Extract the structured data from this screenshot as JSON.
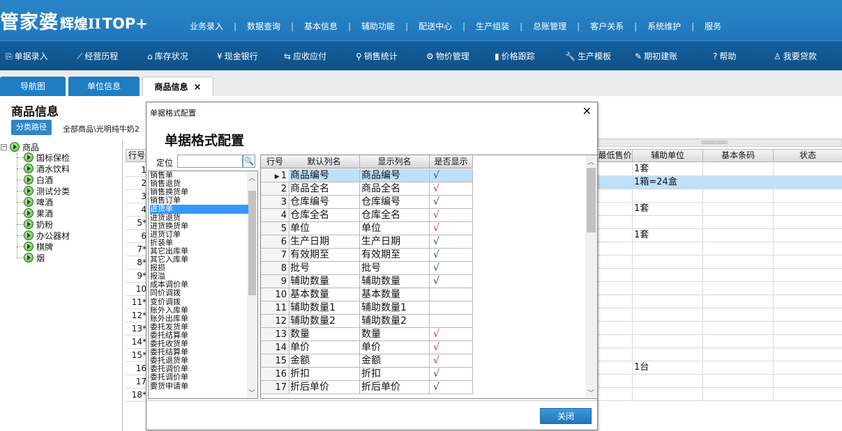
{
  "app": {
    "brand_main": "管家婆",
    "brand_sub": "辉煌II",
    "brand_top": "TOP+"
  },
  "top_menu": [
    "业务录入",
    "数据查询",
    "基本信息",
    "辅助功能",
    "配送中心",
    "生产组装",
    "总账管理",
    "客户关系",
    "系统维护",
    "服务"
  ],
  "top_menu_separator": "|",
  "toolbar": [
    {
      "label": "单据录入",
      "icon": "document-icon",
      "glyph": "⎘"
    },
    {
      "label": "经营历程",
      "icon": "chart-line-icon",
      "glyph": "⟋"
    },
    {
      "label": "库存状况",
      "icon": "home-icon",
      "glyph": "⌂"
    },
    {
      "label": "现金银行",
      "icon": "yen-icon",
      "glyph": "¥"
    },
    {
      "label": "应收应付",
      "icon": "exchange-icon",
      "glyph": "⇆"
    },
    {
      "label": "销售统计",
      "icon": "search-icon",
      "glyph": "⚲"
    },
    {
      "label": "物价管理",
      "icon": "gear-icon",
      "glyph": "⚙"
    },
    {
      "label": "价格跟踪",
      "icon": "bar-chart-icon",
      "glyph": "▮"
    },
    {
      "label": "生产模板",
      "icon": "wrench-icon",
      "glyph": "🔧"
    },
    {
      "label": "期初建账",
      "icon": "edit-icon",
      "glyph": "✎"
    },
    {
      "label": "帮助",
      "icon": "help-icon",
      "glyph": "?"
    },
    {
      "label": "我要贷款",
      "icon": "money-bag-icon",
      "glyph": "♙"
    }
  ],
  "tabs": [
    {
      "label": "导航图"
    },
    {
      "label": "单位信息"
    },
    {
      "label": "商品信息",
      "close": "×"
    }
  ],
  "page": {
    "title": "商品信息",
    "path_button": "分类路径",
    "path_text": "全部商品\\光明纯牛奶2"
  },
  "tree": {
    "root": "商品",
    "children": [
      "国标保检",
      "酒水饮料",
      "白酒",
      "测试分类",
      "啤酒",
      "果酒",
      "奶粉",
      "办公器材",
      "棋牌",
      "烟"
    ]
  },
  "background_grid": {
    "row_header": "行号",
    "row_numbers": [
      "1",
      "2",
      "3",
      "4",
      "5*",
      "6",
      "7*",
      "8*",
      "9*",
      "10",
      "11*",
      "12*",
      "13*",
      "14*",
      "15*",
      "16",
      "17",
      "18*"
    ],
    "headers": [
      "最低售价",
      "辅助单位",
      "基本条码",
      "状态"
    ],
    "aux_units": [
      "1套",
      "1箱=24盒",
      "",
      "1套",
      "",
      "1套",
      "",
      "",
      "",
      "",
      "",
      "",
      "",
      "",
      "",
      "1台",
      "",
      ""
    ],
    "selected_row": 2
  },
  "dialog": {
    "title": "单据格式配置",
    "heading": "单据格式配置",
    "close_icon": "✕",
    "locate_label": "定位",
    "locate_value": "",
    "locate_button": "🔍",
    "bill_types": [
      "销售单",
      "销售退货",
      "销售换货单",
      "销售订单",
      "进货单",
      "进货退货",
      "进货换货单",
      "进货订单",
      "折装单",
      "其它出库单",
      "其它入库单",
      "报损",
      "报溢",
      "成本调价单",
      "同价调拨",
      "变价调拨",
      "账外入库单",
      "账外出库单",
      "委托发货单",
      "委托结算单",
      "委托收货单",
      "委托结算单",
      "委托退货单",
      "委托调价单",
      "委托调价单",
      "要货申请单"
    ],
    "selected_bill": 4,
    "columns": [
      "行号",
      "默认列名",
      "显示列名",
      "是否显示"
    ],
    "rows": [
      {
        "no": "1",
        "default": "商品编号",
        "display": "商品编号",
        "shown": "blue"
      },
      {
        "no": "2",
        "default": "商品全名",
        "display": "商品全名",
        "shown": "red"
      },
      {
        "no": "3",
        "default": "仓库编号",
        "display": "仓库编号",
        "shown": "blue"
      },
      {
        "no": "4",
        "default": "仓库全名",
        "display": "仓库全名",
        "shown": "red"
      },
      {
        "no": "5",
        "default": "单位",
        "display": "单位",
        "shown": "red"
      },
      {
        "no": "6",
        "default": "生产日期",
        "display": "生产日期",
        "shown": "blue"
      },
      {
        "no": "7",
        "default": "有效期至",
        "display": "有效期至",
        "shown": "blue"
      },
      {
        "no": "8",
        "default": "批号",
        "display": "批号",
        "shown": "blue"
      },
      {
        "no": "9",
        "default": "辅助数量",
        "display": "辅助数量",
        "shown": "blue"
      },
      {
        "no": "10",
        "default": "基本数量",
        "display": "基本数量",
        "shown": ""
      },
      {
        "no": "11",
        "default": "辅助数量1",
        "display": "辅助数量1",
        "shown": ""
      },
      {
        "no": "12",
        "default": "辅助数量2",
        "display": "辅助数量2",
        "shown": ""
      },
      {
        "no": "13",
        "default": "数量",
        "display": "数量",
        "shown": "red"
      },
      {
        "no": "14",
        "default": "单价",
        "display": "单价",
        "shown": "red"
      },
      {
        "no": "15",
        "default": "金额",
        "display": "金额",
        "shown": "red"
      },
      {
        "no": "16",
        "default": "折扣",
        "display": "折扣",
        "shown": "blue"
      },
      {
        "no": "17",
        "default": "折后单价",
        "display": "折后单价",
        "shown": "blue"
      }
    ],
    "selected_row": 0,
    "check_glyph": "√",
    "close_button": "关闭"
  },
  "colors": {
    "header_blue": "#1f77bb",
    "toolbar_blue": "#0e5188",
    "check_blue": "#1a3f8f",
    "check_red": "#e02020",
    "selection": "#3399ff"
  }
}
